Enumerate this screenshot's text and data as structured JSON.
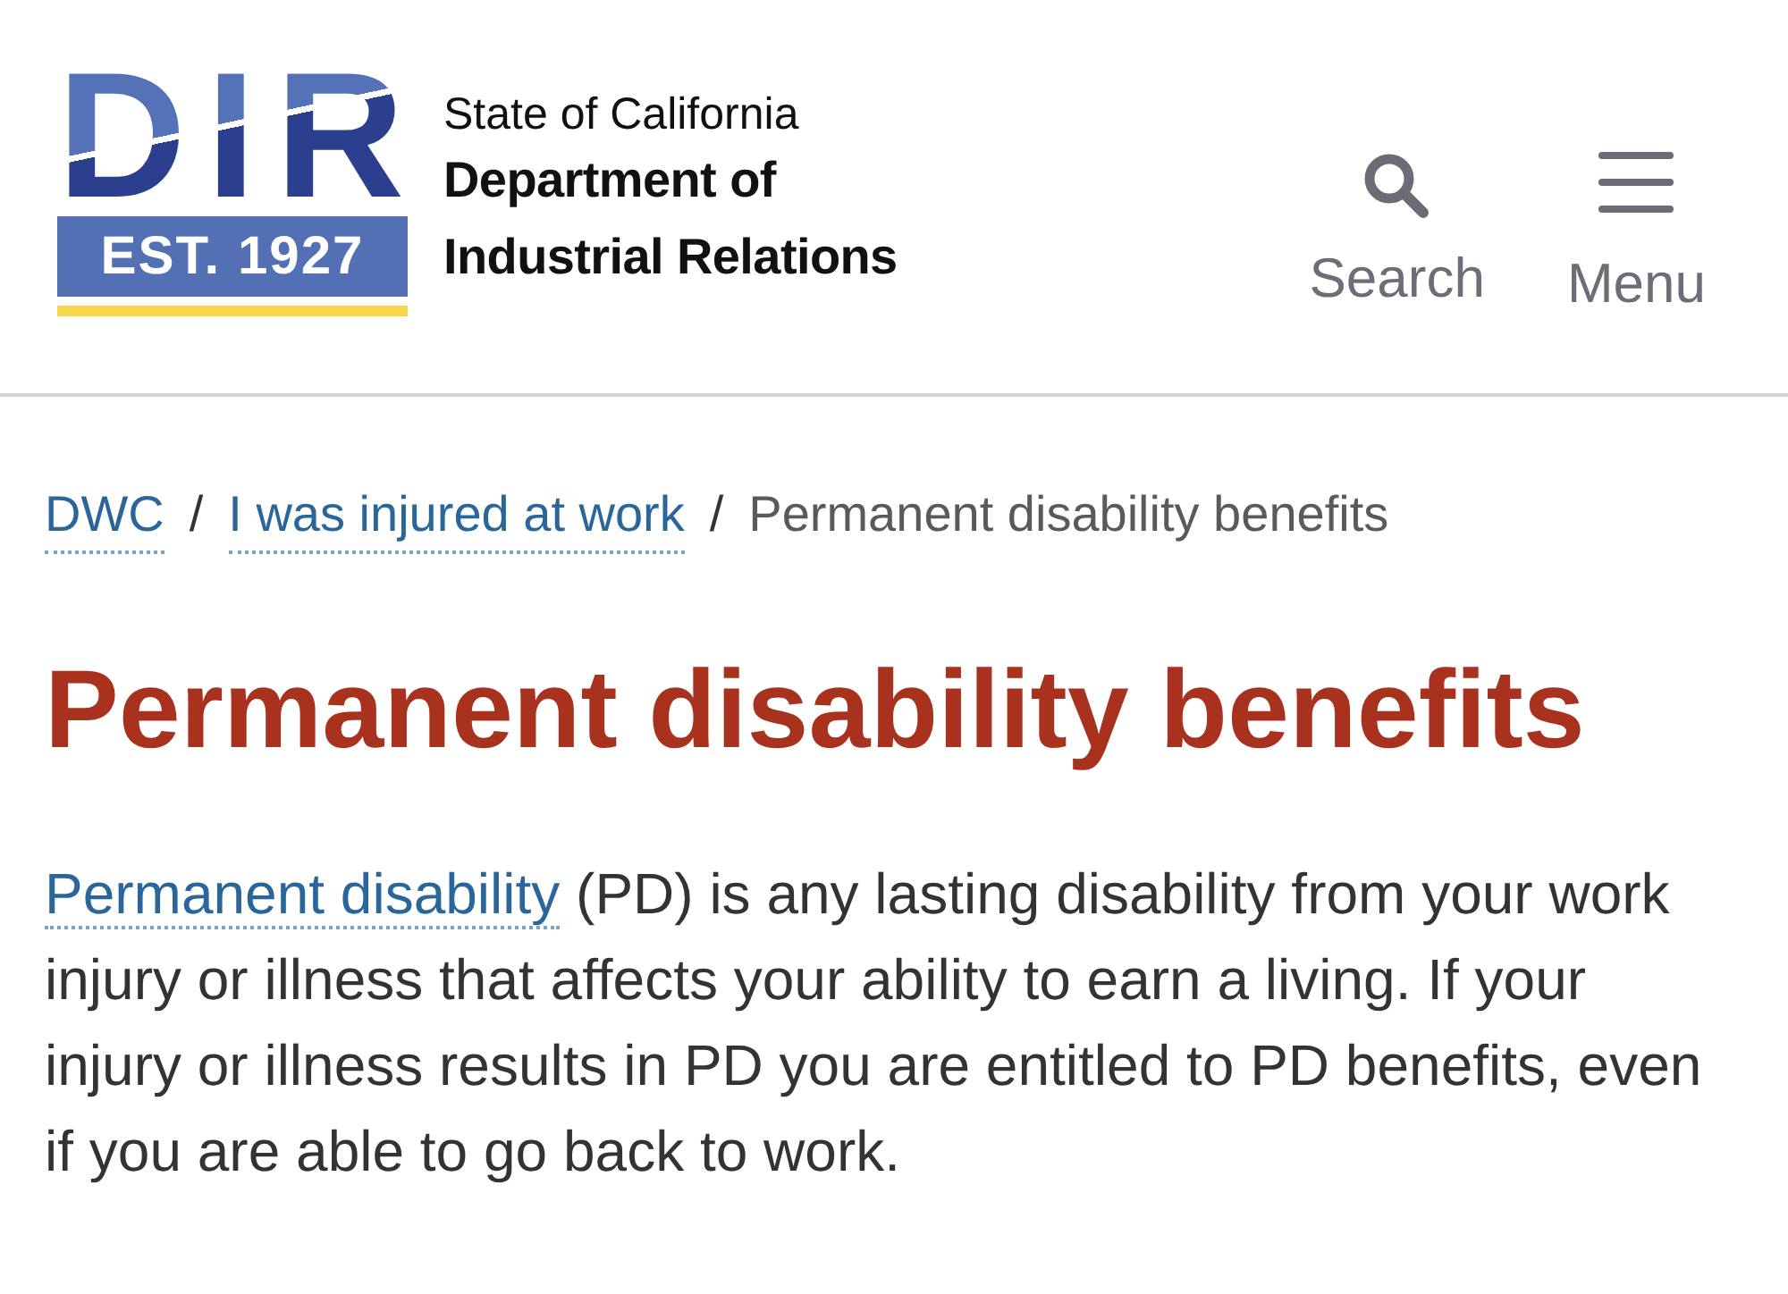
{
  "header": {
    "logo": {
      "wordmark": "DIR",
      "established": "EST. 1927"
    },
    "agency": {
      "state": "State of California",
      "name_lines": [
        "Department of",
        "Industrial Relations"
      ]
    },
    "actions": [
      {
        "kind": "search",
        "label": "Search"
      },
      {
        "kind": "menu",
        "label": "Menu"
      }
    ]
  },
  "breadcrumb": [
    {
      "kind": "link",
      "label": "DWC"
    },
    {
      "kind": "link",
      "separator": "/",
      "label": "I was injured at work"
    },
    {
      "kind": "current",
      "separator": "/",
      "label": "Permanent disability benefits"
    }
  ],
  "page_title": "Permanent disability benefits",
  "intro": {
    "link": "Permanent disability",
    "text": "(PD) is any lasting disability from your work injury or illness that affects your ability to earn a living. If your injury or illness results in PD you are entitled to PD benefits, even if you are able to go back to work."
  }
}
